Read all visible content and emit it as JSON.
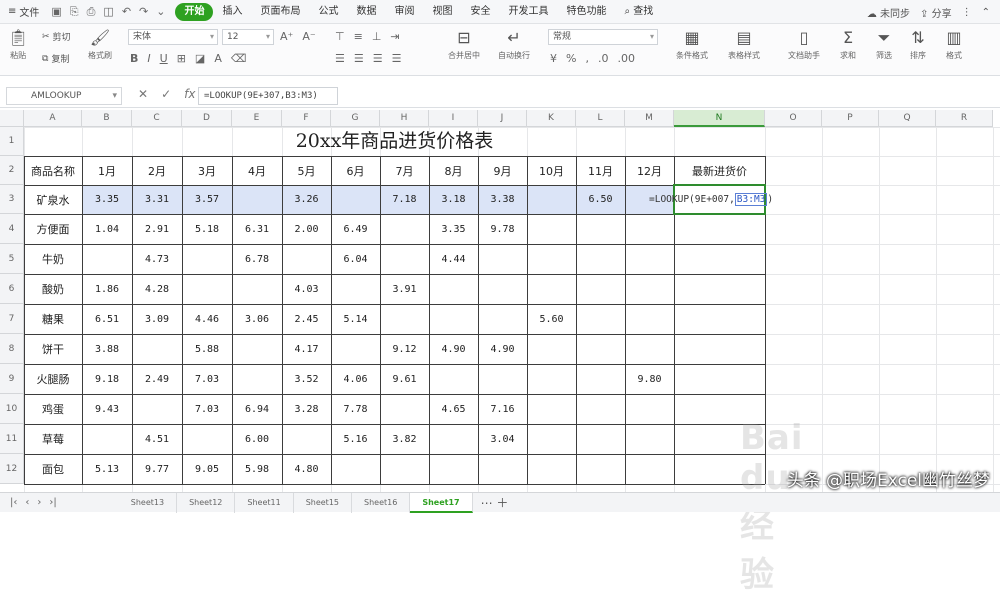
{
  "menubar": {
    "file_label": "文件",
    "tabs": [
      "开始",
      "插入",
      "页面布局",
      "公式",
      "数据",
      "审阅",
      "视图",
      "安全",
      "开发工具",
      "特色功能"
    ],
    "active_tab": "开始",
    "search_label": "查找",
    "right": {
      "sync": "未同步",
      "share": "分享"
    }
  },
  "ribbon": {
    "cut": "剪切",
    "paste": "粘贴",
    "copy": "复制",
    "format_painter": "格式刷",
    "font_name": "宋体",
    "font_size": "12",
    "bold": "B",
    "italic": "I",
    "underline": "U",
    "merge": "合并居中",
    "wrap": "自动换行",
    "number_format": "常规",
    "cond_format": "条件格式",
    "table_style": "表格样式",
    "doc_helper": "文档助手",
    "sum": "求和",
    "filter": "筛选",
    "sort": "排序",
    "format": "格式"
  },
  "formula_bar": {
    "name_box": "AMLOOKUP",
    "formula": "=LOOKUP(9E+307,B3:M3)"
  },
  "sheet": {
    "title": "20xx年商品进货价格表",
    "columns": [
      "A",
      "B",
      "C",
      "D",
      "E",
      "F",
      "G",
      "H",
      "I",
      "J",
      "K",
      "L",
      "M",
      "N",
      "O",
      "P",
      "Q",
      "R"
    ],
    "row_numbers": [
      "1",
      "2",
      "3",
      "4",
      "5",
      "6",
      "7",
      "8",
      "9",
      "10",
      "11",
      "12"
    ],
    "headers": [
      "商品名称",
      "1月",
      "2月",
      "3月",
      "4月",
      "5月",
      "6月",
      "7月",
      "8月",
      "9月",
      "10月",
      "11月",
      "12月",
      "最新进货价"
    ],
    "rows": [
      {
        "name": "矿泉水",
        "values": [
          "3.35",
          "3.31",
          "3.57",
          "",
          "3.26",
          "",
          "7.18",
          "3.18",
          "3.38",
          "",
          "6.50",
          ""
        ]
      },
      {
        "name": "方便面",
        "values": [
          "1.04",
          "2.91",
          "5.18",
          "6.31",
          "2.00",
          "6.49",
          "",
          "3.35",
          "9.78",
          "",
          "",
          ""
        ]
      },
      {
        "name": "牛奶",
        "values": [
          "",
          "4.73",
          "",
          "6.78",
          "",
          "6.04",
          "",
          "4.44",
          "",
          "",
          "",
          ""
        ]
      },
      {
        "name": "酸奶",
        "values": [
          "1.86",
          "4.28",
          "",
          "",
          "4.03",
          "",
          "3.91",
          "",
          "",
          "",
          "",
          ""
        ]
      },
      {
        "name": "糖果",
        "values": [
          "6.51",
          "3.09",
          "4.46",
          "3.06",
          "2.45",
          "5.14",
          "",
          "",
          "",
          "5.60",
          "",
          ""
        ]
      },
      {
        "name": "饼干",
        "values": [
          "3.88",
          "",
          "5.88",
          "",
          "4.17",
          "",
          "9.12",
          "4.90",
          "4.90",
          "",
          "",
          ""
        ]
      },
      {
        "name": "火腿肠",
        "values": [
          "9.18",
          "2.49",
          "7.03",
          "",
          "3.52",
          "4.06",
          "9.61",
          "",
          "",
          "",
          "",
          "9.80"
        ]
      },
      {
        "name": "鸡蛋",
        "values": [
          "9.43",
          "",
          "7.03",
          "6.94",
          "3.28",
          "7.78",
          "",
          "4.65",
          "7.16",
          "",
          "",
          ""
        ]
      },
      {
        "name": "草莓",
        "values": [
          "",
          "4.51",
          "",
          "6.00",
          "",
          "5.16",
          "3.82",
          "",
          "3.04",
          "",
          "",
          ""
        ]
      },
      {
        "name": "面包",
        "values": [
          "5.13",
          "9.77",
          "9.05",
          "5.98",
          "4.80",
          "",
          "",
          "",
          "",
          "",
          "",
          ""
        ]
      }
    ],
    "editing_formula_prefix": "=LOOKUP(9E+007,",
    "editing_formula_ref": "B3:M3",
    "editing_formula_suffix": ")"
  },
  "tabs": {
    "sheets": [
      "Sheet13",
      "Sheet12",
      "Sheet11",
      "Sheet15",
      "Sheet16",
      "Sheet17"
    ],
    "active": "Sheet17"
  },
  "watermark_text": "Bai du 经验",
  "credit_text": "头条 @职场Excel幽竹丝梦"
}
